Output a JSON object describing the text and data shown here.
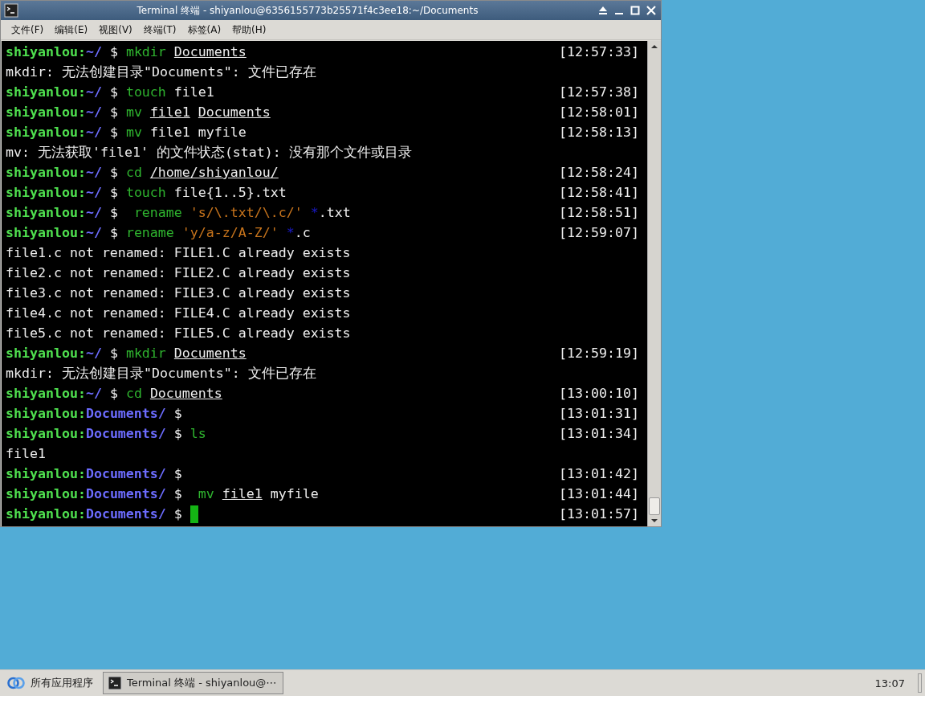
{
  "window": {
    "title": "Terminal 终端 - shiyanlou@6356155773b25571f4c3ee18:~/Documents"
  },
  "menu": [
    "文件(F)",
    "编辑(E)",
    "视图(V)",
    "终端(T)",
    "标签(A)",
    "帮助(H)"
  ],
  "terminal": {
    "lines": [
      {
        "kind": "prompt",
        "user": "shiyanlou:",
        "path": "~/",
        "symbol": "$",
        "segments": [
          {
            "kind": "cmd",
            "text": "mkdir"
          },
          {
            "kind": "link",
            "text": "Documents"
          }
        ],
        "time": "[12:57:33]"
      },
      {
        "kind": "output",
        "text": "mkdir: 无法创建目录\"Documents\": 文件已存在"
      },
      {
        "kind": "prompt",
        "user": "shiyanlou:",
        "path": "~/",
        "symbol": "$",
        "segments": [
          {
            "kind": "cmd",
            "text": "touch"
          },
          {
            "kind": "plain",
            "text": "file1"
          }
        ],
        "time": "[12:57:38]"
      },
      {
        "kind": "prompt",
        "user": "shiyanlou:",
        "path": "~/",
        "symbol": "$",
        "segments": [
          {
            "kind": "cmd",
            "text": "mv"
          },
          {
            "kind": "link",
            "text": "file1"
          },
          {
            "kind": "link",
            "text": "Documents"
          }
        ],
        "time": "[12:58:01]"
      },
      {
        "kind": "prompt",
        "user": "shiyanlou:",
        "path": "~/",
        "symbol": "$",
        "segments": [
          {
            "kind": "cmd",
            "text": "mv"
          },
          {
            "kind": "plain",
            "text": "file1 myfile"
          }
        ],
        "time": "[12:58:13]"
      },
      {
        "kind": "output",
        "text": "mv: 无法获取'file1' 的文件状态(stat): 没有那个文件或目录"
      },
      {
        "kind": "prompt",
        "user": "shiyanlou:",
        "path": "~/",
        "symbol": "$",
        "segments": [
          {
            "kind": "cmd",
            "text": "cd"
          },
          {
            "kind": "link",
            "text": "/home/shiyanlou/"
          }
        ],
        "time": "[12:58:24]"
      },
      {
        "kind": "prompt",
        "user": "shiyanlou:",
        "path": "~/",
        "symbol": "$",
        "segments": [
          {
            "kind": "cmd",
            "text": "touch"
          },
          {
            "kind": "plain",
            "text": "file{1..5}.txt"
          }
        ],
        "time": "[12:58:41]"
      },
      {
        "kind": "prompt",
        "user": "shiyanlou:",
        "path": "~/",
        "symbol": "$",
        "segments": [
          {
            "kind": "cmd",
            "text": " rename"
          },
          {
            "kind": "string",
            "text": "'s/\\.txt/\\.c/'"
          },
          {
            "kind": "glob",
            "text": "*"
          },
          {
            "kind": "plain",
            "text": ".txt",
            "attached": true
          }
        ],
        "time": "[12:58:51]"
      },
      {
        "kind": "prompt",
        "user": "shiyanlou:",
        "path": "~/",
        "symbol": "$",
        "segments": [
          {
            "kind": "cmd",
            "text": "rename"
          },
          {
            "kind": "string",
            "text": "'y/a-z/A-Z/'"
          },
          {
            "kind": "glob",
            "text": "*"
          },
          {
            "kind": "plain",
            "text": ".c",
            "attached": true
          }
        ],
        "time": "[12:59:07]"
      },
      {
        "kind": "output",
        "text": "file1.c not renamed: FILE1.C already exists"
      },
      {
        "kind": "output",
        "text": "file2.c not renamed: FILE2.C already exists"
      },
      {
        "kind": "output",
        "text": "file3.c not renamed: FILE3.C already exists"
      },
      {
        "kind": "output",
        "text": "file4.c not renamed: FILE4.C already exists"
      },
      {
        "kind": "output",
        "text": "file5.c not renamed: FILE5.C already exists"
      },
      {
        "kind": "prompt",
        "user": "shiyanlou:",
        "path": "~/",
        "symbol": "$",
        "segments": [
          {
            "kind": "cmd",
            "text": "mkdir"
          },
          {
            "kind": "link",
            "text": "Documents"
          }
        ],
        "time": "[12:59:19]"
      },
      {
        "kind": "output",
        "text": "mkdir: 无法创建目录\"Documents\": 文件已存在"
      },
      {
        "kind": "prompt",
        "user": "shiyanlou:",
        "path": "~/",
        "symbol": "$",
        "segments": [
          {
            "kind": "cmd",
            "text": "cd"
          },
          {
            "kind": "link",
            "text": "Documents"
          }
        ],
        "time": "[13:00:10]"
      },
      {
        "kind": "prompt",
        "user": "shiyanlou:",
        "path": "Documents/",
        "symbol": "$",
        "time": "[13:01:31]"
      },
      {
        "kind": "prompt",
        "user": "shiyanlou:",
        "path": "Documents/",
        "symbol": "$",
        "segments": [
          {
            "kind": "cmd",
            "text": "ls"
          }
        ],
        "time": "[13:01:34]"
      },
      {
        "kind": "output",
        "text": "file1"
      },
      {
        "kind": "prompt",
        "user": "shiyanlou:",
        "path": "Documents/",
        "symbol": "$",
        "time": "[13:01:42]"
      },
      {
        "kind": "prompt",
        "user": "shiyanlou:",
        "path": "Documents/",
        "symbol": "$",
        "segments": [
          {
            "kind": "cmd",
            "text": " mv"
          },
          {
            "kind": "link",
            "text": "file1"
          },
          {
            "kind": "plain",
            "text": "myfile"
          }
        ],
        "time": "[13:01:44]"
      },
      {
        "kind": "prompt",
        "user": "shiyanlou:",
        "path": "Documents/",
        "symbol": "$",
        "cursor": true,
        "time": "[13:01:57]"
      }
    ]
  },
  "taskbar": {
    "start": "所有应用程序",
    "tasks": [
      {
        "label": "Terminal 终端 - shiyanlou@⋯",
        "selected": true
      }
    ],
    "clock": "13:07"
  }
}
